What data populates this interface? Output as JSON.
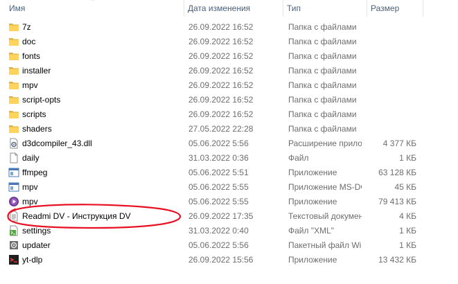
{
  "columns": {
    "name": "Имя",
    "date": "Дата изменения",
    "type": "Тип",
    "size": "Размер"
  },
  "accent_color": "#e81123",
  "files": [
    {
      "icon": "folder-icon",
      "name": "7z",
      "date": "26.09.2022 16:52",
      "type": "Папка с файлами",
      "size": ""
    },
    {
      "icon": "folder-icon",
      "name": "doc",
      "date": "26.09.2022 16:52",
      "type": "Папка с файлами",
      "size": ""
    },
    {
      "icon": "folder-icon",
      "name": "fonts",
      "date": "26.09.2022 16:52",
      "type": "Папка с файлами",
      "size": ""
    },
    {
      "icon": "folder-icon",
      "name": "installer",
      "date": "26.09.2022 16:52",
      "type": "Папка с файлами",
      "size": ""
    },
    {
      "icon": "folder-icon",
      "name": "mpv",
      "date": "26.09.2022 16:52",
      "type": "Папка с файлами",
      "size": ""
    },
    {
      "icon": "folder-icon",
      "name": "script-opts",
      "date": "26.09.2022 16:52",
      "type": "Папка с файлами",
      "size": ""
    },
    {
      "icon": "folder-icon",
      "name": "scripts",
      "date": "26.09.2022 16:52",
      "type": "Папка с файлами",
      "size": ""
    },
    {
      "icon": "folder-icon",
      "name": "shaders",
      "date": "27.05.2022 22:28",
      "type": "Папка с файлами",
      "size": ""
    },
    {
      "icon": "dll-file-icon",
      "name": "d3dcompiler_43.dll",
      "date": "05.06.2022 5:56",
      "type": "Расширение приложения",
      "size": "4 377 КБ"
    },
    {
      "icon": "blank-file-icon",
      "name": "daily",
      "date": "31.03.2022 0:36",
      "type": "Файл",
      "size": "1 КБ"
    },
    {
      "icon": "exe-app-icon",
      "name": "ffmpeg",
      "date": "05.06.2022 5:51",
      "type": "Приложение",
      "size": "63 128 КБ"
    },
    {
      "icon": "exe-app-icon",
      "name": "mpv",
      "date": "05.06.2022 5:55",
      "type": "Приложение MS-DOS",
      "size": "45 КБ"
    },
    {
      "icon": "mpv-app-icon",
      "name": "mpv",
      "date": "05.06.2022 5:55",
      "type": "Приложение",
      "size": "79 413 КБ"
    },
    {
      "icon": "text-document-icon",
      "name": "Readmi DV - Инструкция DV",
      "date": "26.09.2022 17:35",
      "type": "Текстовый документ",
      "size": "4 КБ"
    },
    {
      "icon": "xml-settings-icon",
      "name": "settings",
      "date": "31.03.2022 0:40",
      "type": "Файл \"XML\"",
      "size": "1 КБ"
    },
    {
      "icon": "batch-file-icon",
      "name": "updater",
      "date": "05.06.2022 5:56",
      "type": "Пакетный файл Windows",
      "size": "1 КБ"
    },
    {
      "icon": "yt-dlp-app-icon",
      "name": "yt-dlp",
      "date": "26.09.2022 15:56",
      "type": "Приложение",
      "size": "13 432 КБ"
    }
  ]
}
